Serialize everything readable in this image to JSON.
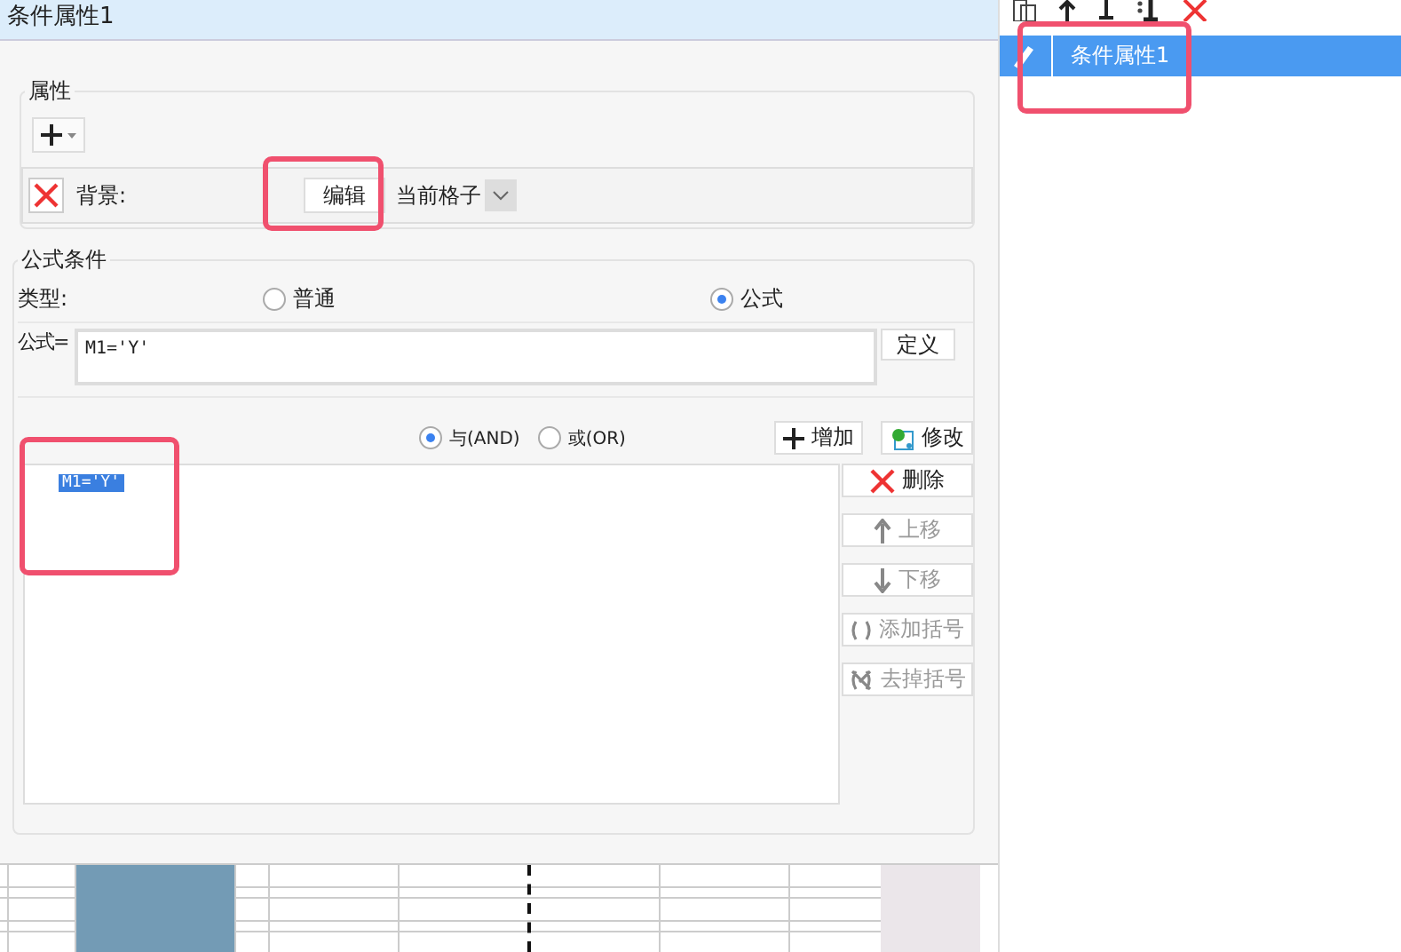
{
  "title": "条件属性1",
  "properties": {
    "legend": "属性",
    "rows": [
      {
        "label": "背景:",
        "edit_button": "编辑",
        "scope": "当前格子"
      }
    ]
  },
  "formula_condition": {
    "legend": "公式条件",
    "type_label": "类型:",
    "types": [
      {
        "label": "普通",
        "selected": false
      },
      {
        "label": "公式",
        "selected": true
      }
    ],
    "formula_label": "公式=",
    "formula_value": "M1='Y'",
    "define_button": "定义",
    "joins": [
      {
        "label": "与(AND)",
        "selected": true
      },
      {
        "label": "或(OR)",
        "selected": false
      }
    ],
    "add_button": "增加",
    "modify_button": "修改",
    "conditions": [
      {
        "text": "M1='Y'",
        "selected": true
      }
    ],
    "actions": [
      {
        "label": "删除",
        "kind": "delete",
        "disabled": false
      },
      {
        "label": "上移",
        "kind": "up",
        "disabled": true
      },
      {
        "label": "下移",
        "kind": "down",
        "disabled": true
      },
      {
        "label": "添加括号",
        "kind": "bracket",
        "disabled": true
      },
      {
        "label": "去掉括号",
        "kind": "unbracket",
        "disabled": true
      }
    ]
  },
  "sheet": {
    "columns": [
      {
        "selected": false
      },
      {
        "selected": true
      },
      {
        "selected": false
      },
      {
        "selected": false
      },
      {
        "selected": false
      },
      {
        "selected": false
      },
      {
        "selected": false
      }
    ]
  },
  "condition_list": [
    {
      "label": "条件属性1",
      "selected": true
    }
  ]
}
